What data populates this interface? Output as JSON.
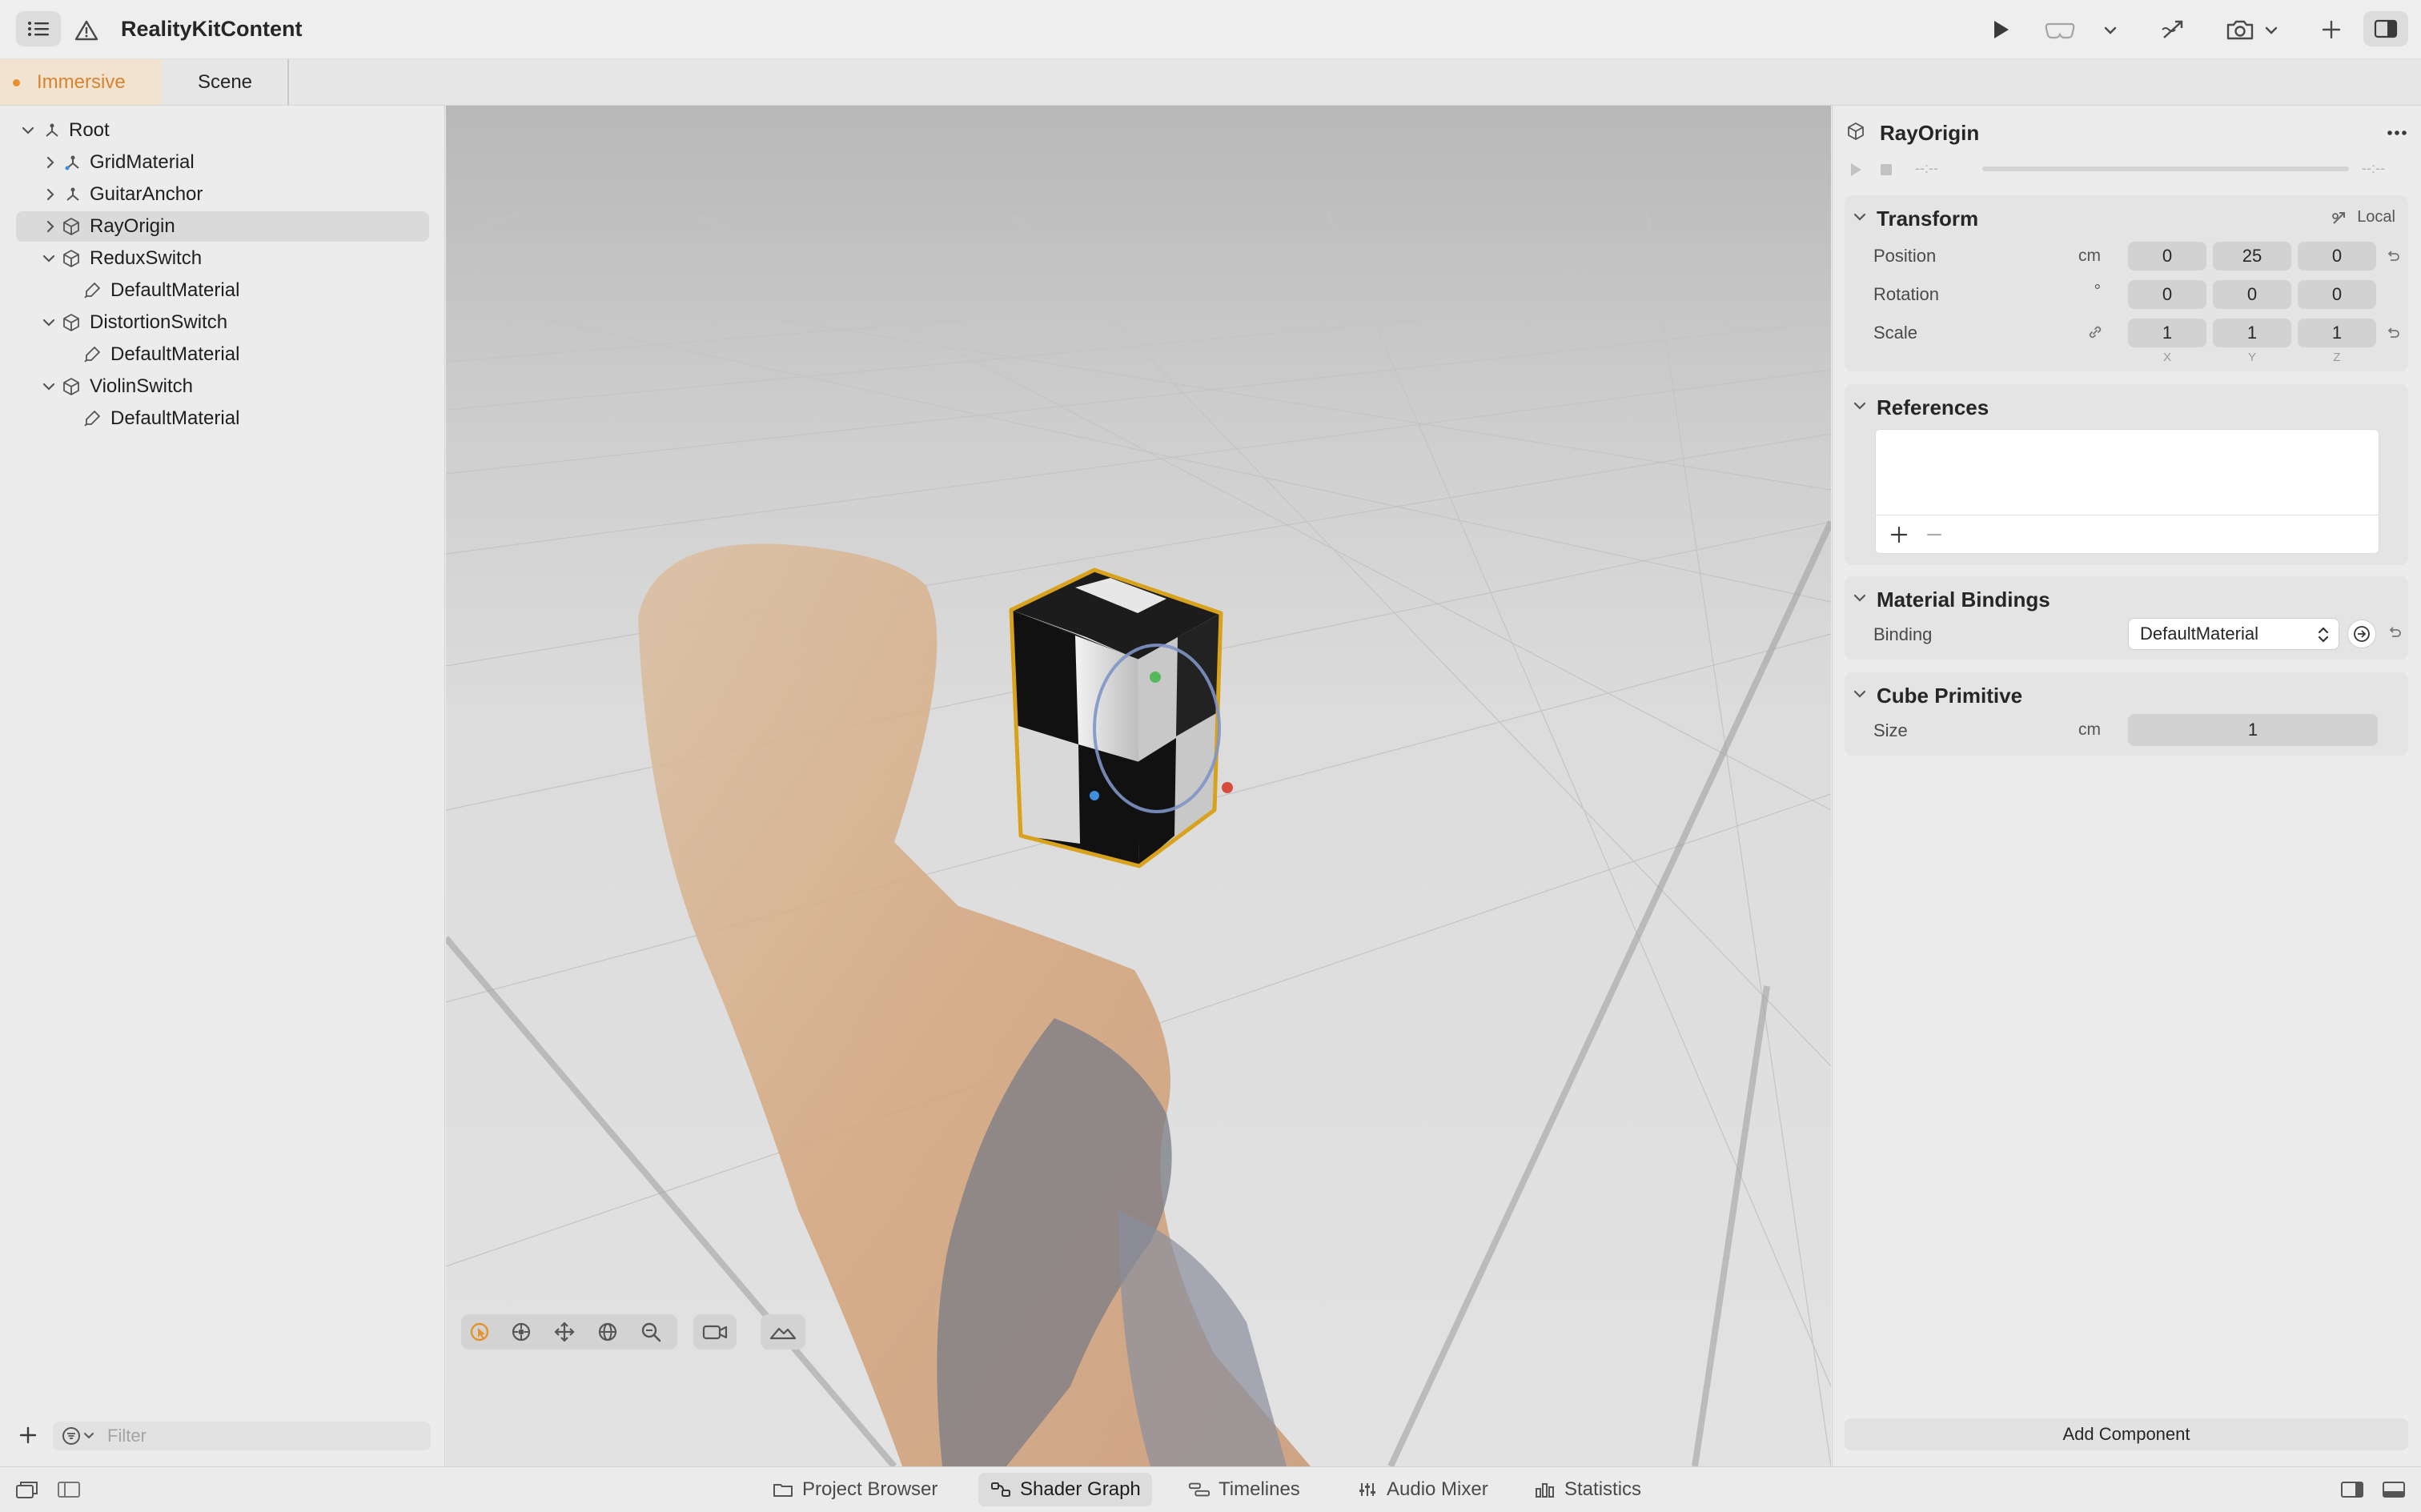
{
  "window": {
    "title": "RealityKitContent"
  },
  "tabs": {
    "immersive_label": "Immersive",
    "scene_label": "Scene"
  },
  "hierarchy": {
    "items": [
      {
        "label": "Root",
        "icon": "entity-icon",
        "expanded": true
      },
      {
        "label": "GridMaterial",
        "icon": "entity-icon",
        "expanded": false
      },
      {
        "label": "GuitarAnchor",
        "icon": "entity-icon",
        "expanded": false
      },
      {
        "label": "RayOrigin",
        "icon": "cube-icon",
        "expanded": false,
        "selected": true
      },
      {
        "label": "ReduxSwitch",
        "icon": "cube-icon",
        "expanded": true
      },
      {
        "label": "DefaultMaterial",
        "icon": "material-icon"
      },
      {
        "label": "DistortionSwitch",
        "icon": "cube-icon",
        "expanded": true
      },
      {
        "label": "DefaultMaterial",
        "icon": "material-icon"
      },
      {
        "label": "ViolinSwitch",
        "icon": "cube-icon",
        "expanded": true
      },
      {
        "label": "DefaultMaterial",
        "icon": "material-icon"
      }
    ],
    "filter_placeholder": "Filter"
  },
  "inspector": {
    "title": "RayOrigin",
    "animation": {
      "time_left": "--:--",
      "time_right": "--:--"
    },
    "transform": {
      "title": "Transform",
      "space": "Local",
      "position_label": "Position",
      "position_unit": "cm",
      "position": [
        "0",
        "25",
        "0"
      ],
      "rotation_label": "Rotation",
      "rotation_unit": "°",
      "rotation": [
        "0",
        "0",
        "0"
      ],
      "scale_label": "Scale",
      "scale": [
        "1",
        "1",
        "1"
      ],
      "axes": [
        "X",
        "Y",
        "Z"
      ]
    },
    "references": {
      "title": "References"
    },
    "material_bindings": {
      "title": "Material Bindings",
      "binding_label": "Binding",
      "binding_value": "DefaultMaterial"
    },
    "cube_primitive": {
      "title": "Cube Primitive",
      "size_label": "Size",
      "size_unit": "cm",
      "size_value": "1"
    },
    "add_component_label": "Add Component"
  },
  "bottom_tabs": {
    "items": [
      {
        "label": "Project Browser",
        "icon": "folder-icon"
      },
      {
        "label": "Shader Graph",
        "icon": "shader-graph-icon",
        "active": true
      },
      {
        "label": "Timelines",
        "icon": "timelines-icon"
      },
      {
        "label": "Audio Mixer",
        "icon": "audio-mixer-icon"
      },
      {
        "label": "Statistics",
        "icon": "statistics-icon"
      }
    ]
  },
  "colors": {
    "accent_orange": "#e8912c",
    "selection_outline": "#d9a21c"
  }
}
